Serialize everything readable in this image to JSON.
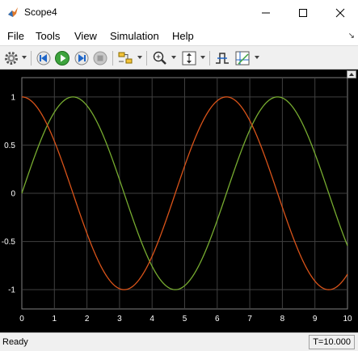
{
  "window": {
    "title": "Scope4"
  },
  "menu": [
    "File",
    "Tools",
    "View",
    "Simulation",
    "Help"
  ],
  "toolbar": [
    "settings-icon",
    "step-back-icon",
    "run-icon",
    "step-forward-icon",
    "stop-icon",
    "highlight-block-icon",
    "zoom-icon",
    "autoscale-icon",
    "triggers-icon",
    "cursor-measurements-icon"
  ],
  "colors": {
    "plot_bg": "#000000",
    "grid": "#404040",
    "sine": "#77ac30",
    "cosine": "#d95319"
  },
  "chart_data": {
    "type": "line",
    "xlim": [
      0,
      10
    ],
    "ylim": [
      -1.2,
      1.2
    ],
    "x_ticks": [
      "0",
      "1",
      "2",
      "3",
      "4",
      "5",
      "6",
      "7",
      "8",
      "9",
      "10"
    ],
    "y_ticks": [
      "1",
      "0.5",
      "0",
      "-0.5",
      "-1"
    ],
    "grid": true,
    "series": [
      {
        "function": "sin",
        "color": "#77ac30",
        "x": [
          0,
          0.5,
          1,
          1.5708,
          2,
          2.5,
          3,
          3.5,
          4,
          4.7124,
          5,
          5.5,
          6,
          6.5,
          7,
          7.854,
          8,
          8.5,
          9,
          9.5,
          10
        ],
        "y": [
          0,
          0.48,
          0.84,
          1,
          0.91,
          0.6,
          0.14,
          -0.35,
          -0.76,
          -1,
          -0.96,
          -0.71,
          -0.28,
          0.22,
          0.66,
          1,
          0.99,
          0.8,
          0.41,
          -0.08,
          -0.54
        ]
      },
      {
        "function": "cos",
        "color": "#d95319",
        "x": [
          0,
          0.5,
          1,
          1.5,
          2,
          2.5,
          3,
          3.1416,
          3.5,
          4,
          4.5,
          5,
          5.5,
          6,
          6.2832,
          6.5,
          7,
          7.5,
          8,
          8.5,
          9,
          9.4248,
          10
        ],
        "y": [
          1,
          0.88,
          0.54,
          0.07,
          -0.42,
          -0.8,
          -0.99,
          -1,
          -0.94,
          -0.65,
          -0.21,
          0.28,
          0.71,
          0.96,
          1,
          0.98,
          0.75,
          0.35,
          -0.15,
          -0.6,
          -0.91,
          -1,
          -0.84
        ]
      }
    ]
  },
  "status": {
    "state": "Ready",
    "time": "T=10.000"
  }
}
